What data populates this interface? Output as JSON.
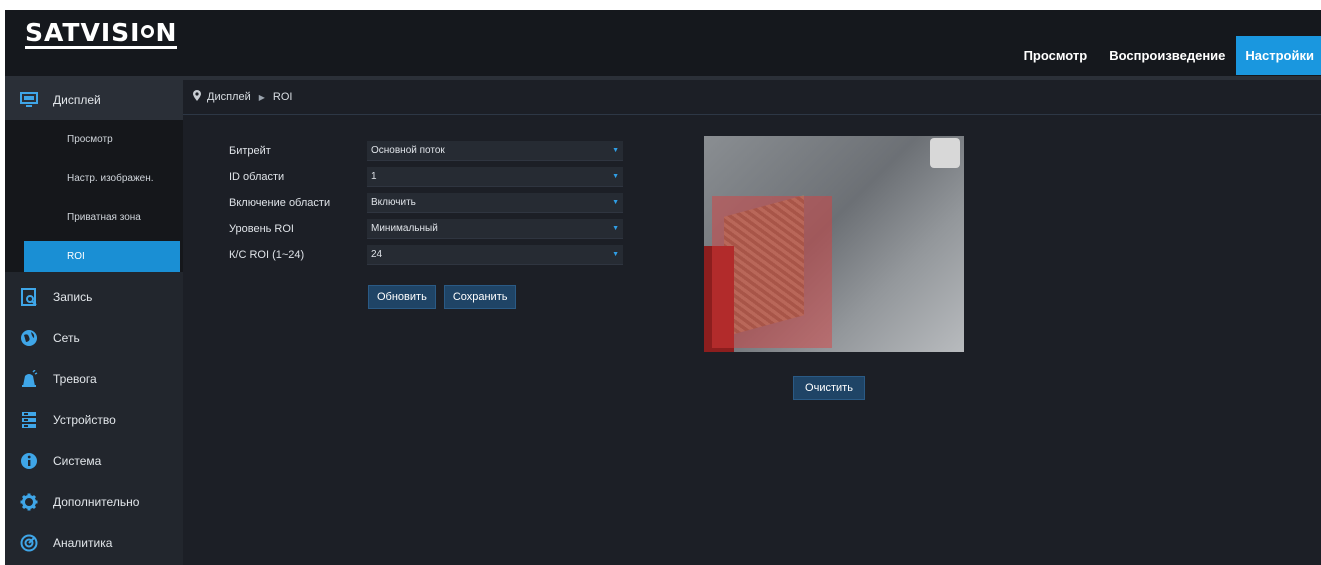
{
  "header": {
    "logo": "SATVISION",
    "logo_parts": [
      "SAT",
      "VISI",
      "N"
    ],
    "nav": [
      {
        "label": "Просмотр",
        "active": false
      },
      {
        "label": "Воспроизведение",
        "active": false
      },
      {
        "label": "Настройки",
        "active": true
      }
    ]
  },
  "sidebar": {
    "display": {
      "label": "Дисплей",
      "icon": "monitor-icon",
      "items": [
        {
          "label": "Просмотр",
          "active": false
        },
        {
          "label": "Настр. изображен.",
          "active": false
        },
        {
          "label": "Приватная зона",
          "active": false
        },
        {
          "label": "ROI",
          "active": true
        }
      ]
    },
    "groups": [
      {
        "label": "Запись",
        "icon": "record-icon"
      },
      {
        "label": "Сеть",
        "icon": "globe-icon"
      },
      {
        "label": "Тревога",
        "icon": "alarm-icon"
      },
      {
        "label": "Устройство",
        "icon": "storage-icon"
      },
      {
        "label": "Система",
        "icon": "info-icon"
      },
      {
        "label": "Дополнительно",
        "icon": "gear-icon"
      },
      {
        "label": "Аналитика",
        "icon": "analytics-icon"
      }
    ]
  },
  "breadcrumb": {
    "section": "Дисплей",
    "page": "ROI"
  },
  "form": {
    "bitrate": {
      "label": "Битрейт",
      "value": "Основной поток"
    },
    "area_id": {
      "label": "ID области",
      "value": "1"
    },
    "area_enable": {
      "label": "Включение области",
      "value": "Включить"
    },
    "roi_level": {
      "label": "Уровень ROI",
      "value": "Минимальный"
    },
    "kc_roi": {
      "label": "К/С ROI (1~24)",
      "value": "24"
    }
  },
  "buttons": {
    "refresh": "Обновить",
    "save": "Сохранить",
    "clear": "Очистить"
  },
  "colors": {
    "accent": "#1a97df",
    "roi": "#e03c3c"
  }
}
